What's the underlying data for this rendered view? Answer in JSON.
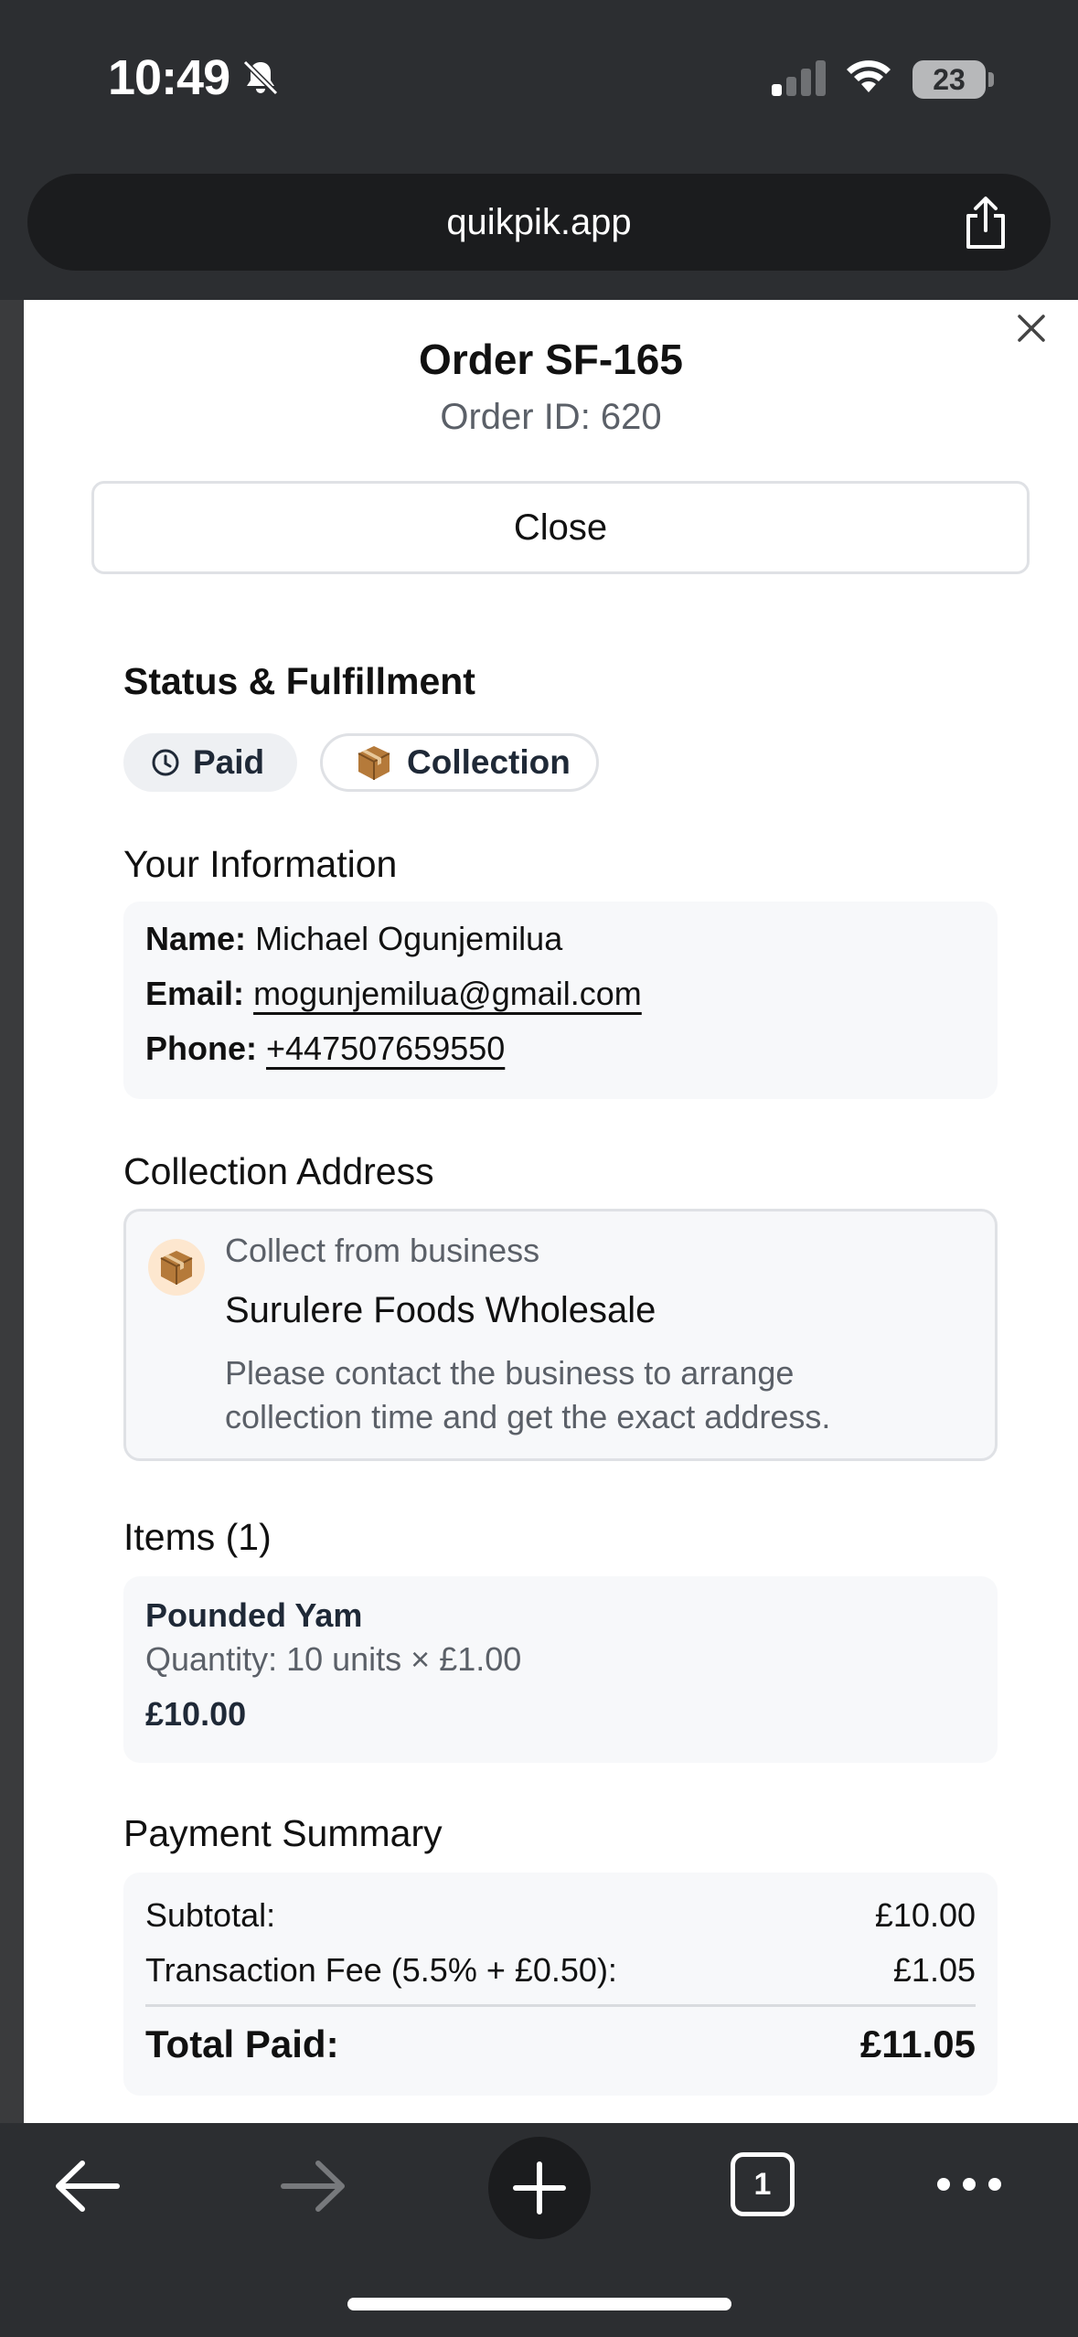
{
  "status_bar": {
    "time": "10:49",
    "battery": "23"
  },
  "browser": {
    "url": "quikpik.app",
    "tab_count": "1"
  },
  "order": {
    "title": "Order SF-165",
    "order_id": "Order ID: 620",
    "close_label": "Close",
    "status_heading": "Status & Fulfillment",
    "status_chip": "Paid",
    "fulfillment_chip": "Collection",
    "info_heading": "Your Information",
    "info": {
      "name_label": "Name:",
      "name": "Michael Ogunjemilua",
      "email_label": "Email:",
      "email": "mogunjemilua@gmail.com",
      "phone_label": "Phone:",
      "phone": "+447507659550"
    },
    "address_heading": "Collection Address",
    "address": {
      "collect_from": "Collect from business",
      "business": "Surulere Foods Wholesale",
      "note_line1": "Please contact the business to arrange",
      "note_line2": "collection time and get the exact address."
    },
    "items_heading": "Items (1)",
    "items": [
      {
        "name": "Pounded Yam",
        "quantity": "Quantity: 10 units × £1.00",
        "price": "£10.00"
      }
    ],
    "payment_heading": "Payment Summary",
    "payment": {
      "subtotal_label": "Subtotal:",
      "subtotal": "£10.00",
      "fee_label": "Transaction Fee (5.5% + £0.50):",
      "fee": "£1.05",
      "total_label": "Total Paid:",
      "total": "£11.05"
    }
  },
  "colors": {
    "accent_dark": "#1b1c1e",
    "muted_text": "#5b6068",
    "card_bg": "#f7f8fa"
  }
}
